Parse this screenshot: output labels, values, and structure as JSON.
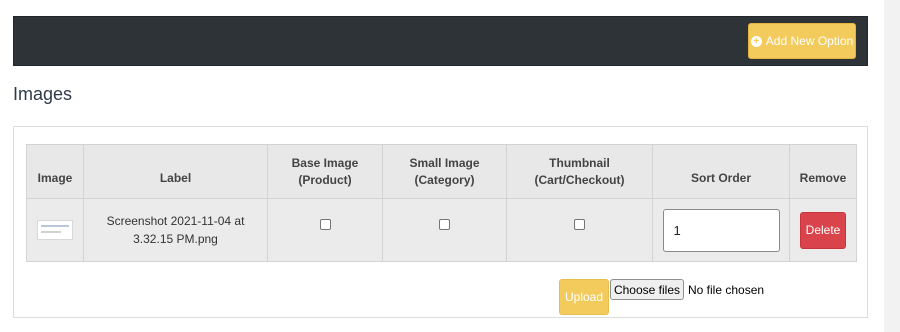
{
  "toolbar": {
    "add_option_label": "Add New Option",
    "add_option_icon": "plus-circle-icon"
  },
  "section": {
    "title": "Images"
  },
  "table": {
    "headers": {
      "image": "Image",
      "label": "Label",
      "base_image_line1": "Base Image",
      "base_image_line2": "(Product)",
      "small_image_line1": "Small Image",
      "small_image_line2": "(Category)",
      "thumbnail_line1": "Thumbnail",
      "thumbnail_line2": "(Cart/Checkout)",
      "sort_order": "Sort Order",
      "remove": "Remove"
    },
    "rows": [
      {
        "label_line1": "Screenshot 2021-11-04 at",
        "label_line2": "3.32.15 PM.png",
        "base_image_checked": false,
        "small_image_checked": false,
        "thumbnail_checked": false,
        "sort_order": "1",
        "delete_label": "Delete"
      }
    ]
  },
  "upload": {
    "upload_label": "Upload",
    "choose_files_label": "Choose files",
    "file_status": "No file chosen"
  },
  "colors": {
    "top_bar": "#2e3338",
    "accent_yellow": "#f2cb5c",
    "delete_red": "#d9434b",
    "header_bg": "#e8e8e8"
  }
}
